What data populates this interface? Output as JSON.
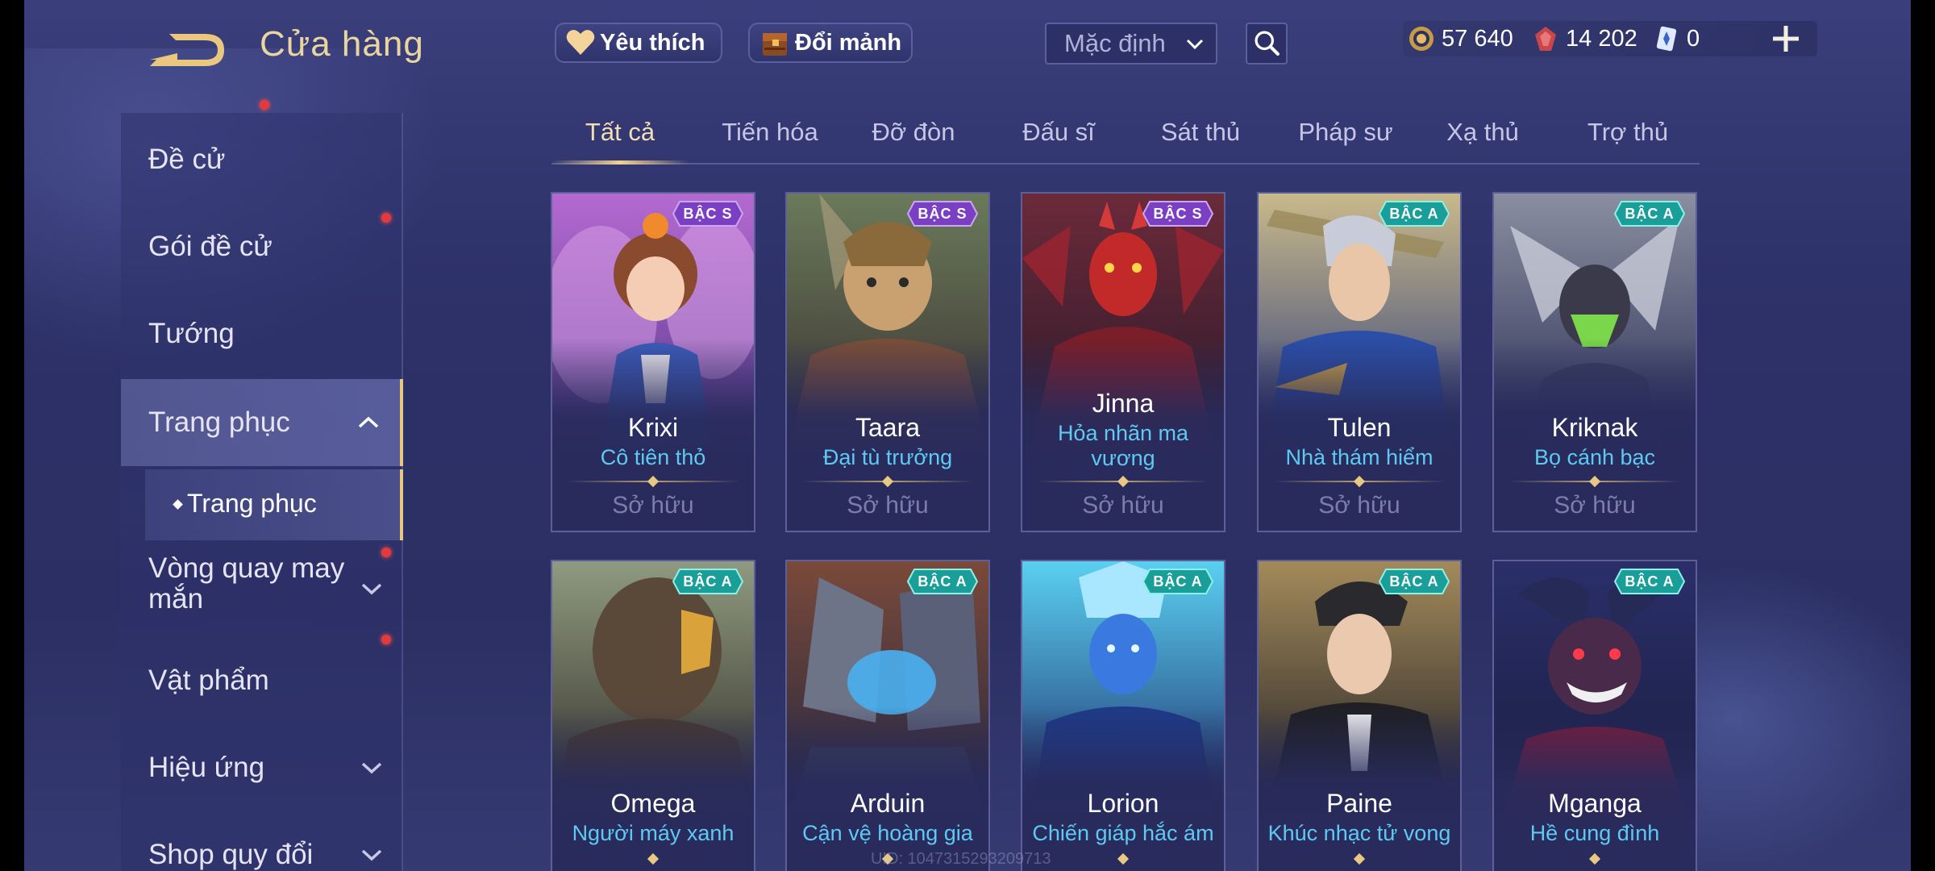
{
  "header": {
    "title": "Cửa hàng",
    "favorites_label": "Yêu thích",
    "shard_exchange_label": "Đổi mảnh",
    "sort_value": "Mặc định"
  },
  "currencies": {
    "gold": "57 640",
    "vouchers": "14 202",
    "cards": "0"
  },
  "sidebar": {
    "items": [
      {
        "label": "Đề cử"
      },
      {
        "label": "Gói đề cử"
      },
      {
        "label": "Tướng"
      },
      {
        "label": "Trang phục"
      },
      {
        "label": "Vòng quay may mắn"
      },
      {
        "label": "Vật phẩm"
      },
      {
        "label": "Hiệu ứng"
      },
      {
        "label": "Shop quy đổi"
      }
    ],
    "sub_item": "Trang phục"
  },
  "tabs": [
    "Tất cả",
    "Tiến hóa",
    "Đỡ đòn",
    "Đấu sĩ",
    "Sát thủ",
    "Pháp sư",
    "Xạ thủ",
    "Trợ thủ"
  ],
  "cards": [
    {
      "hero": "Krixi",
      "skin": "Cô tiên thỏ",
      "tier": "BẬC S",
      "status": "Sở hữu"
    },
    {
      "hero": "Taara",
      "skin": "Đại tù trưởng",
      "tier": "BẬC S",
      "status": "Sở hữu"
    },
    {
      "hero": "Jinna",
      "skin": "Hỏa nhãn ma vương",
      "tier": "BẬC S",
      "status": "Sở hữu"
    },
    {
      "hero": "Tulen",
      "skin": "Nhà thám hiểm",
      "tier": "BẬC A",
      "status": "Sở hữu"
    },
    {
      "hero": "Kriknak",
      "skin": "Bọ cánh bạc",
      "tier": "BẬC A",
      "status": "Sở hữu"
    },
    {
      "hero": "Omega",
      "skin": "Người máy xanh",
      "tier": "BẬC A",
      "status": ""
    },
    {
      "hero": "Arduin",
      "skin": "Cận vệ hoàng gia",
      "tier": "BẬC A",
      "status": ""
    },
    {
      "hero": "Lorion",
      "skin": "Chiến giáp hắc ám",
      "tier": "BẬC A",
      "status": ""
    },
    {
      "hero": "Paine",
      "skin": "Khúc nhạc tử vong",
      "tier": "BẬC A",
      "status": ""
    },
    {
      "hero": "Mganga",
      "skin": "Hề cung đình",
      "tier": "BẬC A",
      "status": ""
    }
  ],
  "footer": {
    "uid": "UID: 1047315293209713"
  },
  "colors": {
    "accent_gold": "#e9c77f",
    "skin_blue": "#5ec9f2",
    "tier_s": "#7b3fc4",
    "tier_a": "#1a9e9a"
  }
}
